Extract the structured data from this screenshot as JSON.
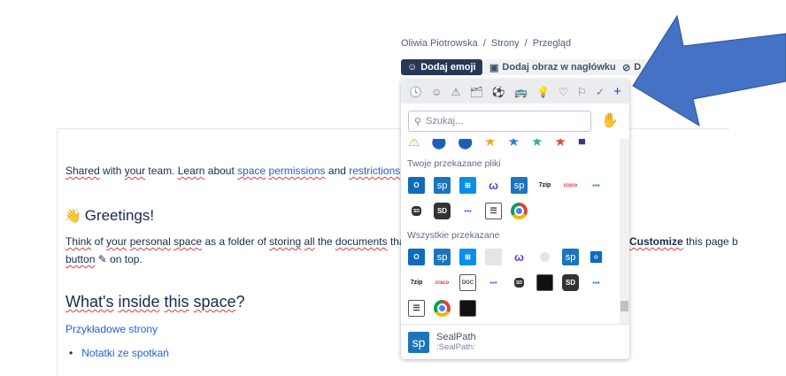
{
  "breadcrumb": [
    "Oliwia Piotrowska",
    "Strony",
    "Przegląd"
  ],
  "breadcrumb_sep": "/",
  "toolbar": {
    "add_emoji": "Dodaj emoji",
    "add_header": "Dodaj obraz w nagłówku",
    "third": "D"
  },
  "page": {
    "intro": [
      "Shared",
      "with",
      "your",
      "team.",
      "Learn",
      "about"
    ],
    "intro_text": {
      "a": "Shared",
      "b": " with ",
      "c": "your",
      "d": " team. ",
      "e": "Learn",
      "f": " about ",
      "g": "space",
      "h": "permissions",
      "i": " and ",
      "j": "restrictions",
      "k": "."
    },
    "greeting_emoji": "👋",
    "greeting": "Greetings!",
    "para1": {
      "a": "Think",
      "b": " of ",
      "c": "your",
      "d": "personal",
      "e": "space",
      "f": " as a folder of ",
      "g": "storing",
      "h": "all",
      "i": " the ",
      "j": "documents",
      "k": " that c",
      "l": "Customize",
      "m": " this page b"
    },
    "para2": {
      "a": "button",
      "b": "✎",
      "c": " on top."
    },
    "h2": {
      "a": "What's",
      "b": "inside",
      "c": "this",
      "d": "space",
      "e": "?"
    },
    "examples": "Przykładowe strony",
    "list": [
      "Notatki ze spotkań"
    ]
  },
  "picker": {
    "categories": [
      "🕓",
      "☺",
      "⚠",
      "🗂",
      "⚽",
      "🚌",
      "💡",
      "♡",
      "⚐",
      "✓",
      "+"
    ],
    "search_placeholder": "Szukaj...",
    "skin_tone": "✋",
    "top_row": [
      "⚠",
      "⬤",
      "⬤",
      "★",
      "★",
      "★",
      "★",
      "■"
    ],
    "section1": "Twoje przekazane pliki",
    "section2": "Wszystkie przekazane",
    "selected": {
      "name": "SealPath",
      "shortcode": ":SealPath:",
      "icon": "sp"
    }
  },
  "icons": {
    "sp": "sp",
    "sd": "SD",
    "sd_small": "SD",
    "zip": "7zip",
    "cisco": "cisco",
    "dots": "▪▪▪",
    "outlook": "O",
    "doc": "DOC"
  },
  "colors": {
    "accent": "#253858",
    "arrow": "#4472c4"
  }
}
